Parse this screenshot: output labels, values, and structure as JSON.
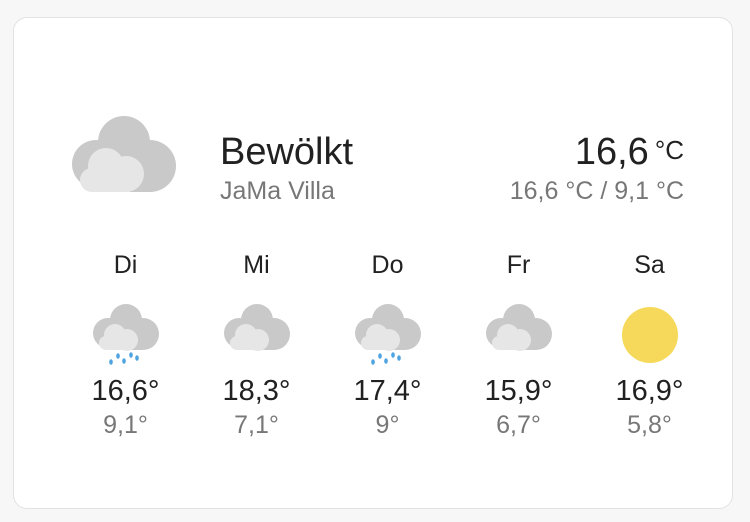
{
  "current": {
    "condition": "Bewölkt",
    "location": "JaMa Villa",
    "temperature": "16,6",
    "unit": "°C",
    "high_low": "16,6 °C / 9,1 °C",
    "icon": "cloudy-icon"
  },
  "forecast": [
    {
      "day": "Di",
      "high": "16,6°",
      "low": "9,1°",
      "icon": "rainy-icon"
    },
    {
      "day": "Mi",
      "high": "18,3°",
      "low": "7,1°",
      "icon": "cloudy-icon"
    },
    {
      "day": "Do",
      "high": "17,4°",
      "low": "9°",
      "icon": "rainy-icon"
    },
    {
      "day": "Fr",
      "high": "15,9°",
      "low": "6,7°",
      "icon": "cloudy-icon"
    },
    {
      "day": "Sa",
      "high": "16,9°",
      "low": "5,8°",
      "icon": "sunny-icon"
    }
  ],
  "colors": {
    "cloud_back": "#c9c9c9",
    "cloud_front": "#e6e6e6",
    "rain": "#4fa3e0",
    "sun": "#f6d95a"
  }
}
